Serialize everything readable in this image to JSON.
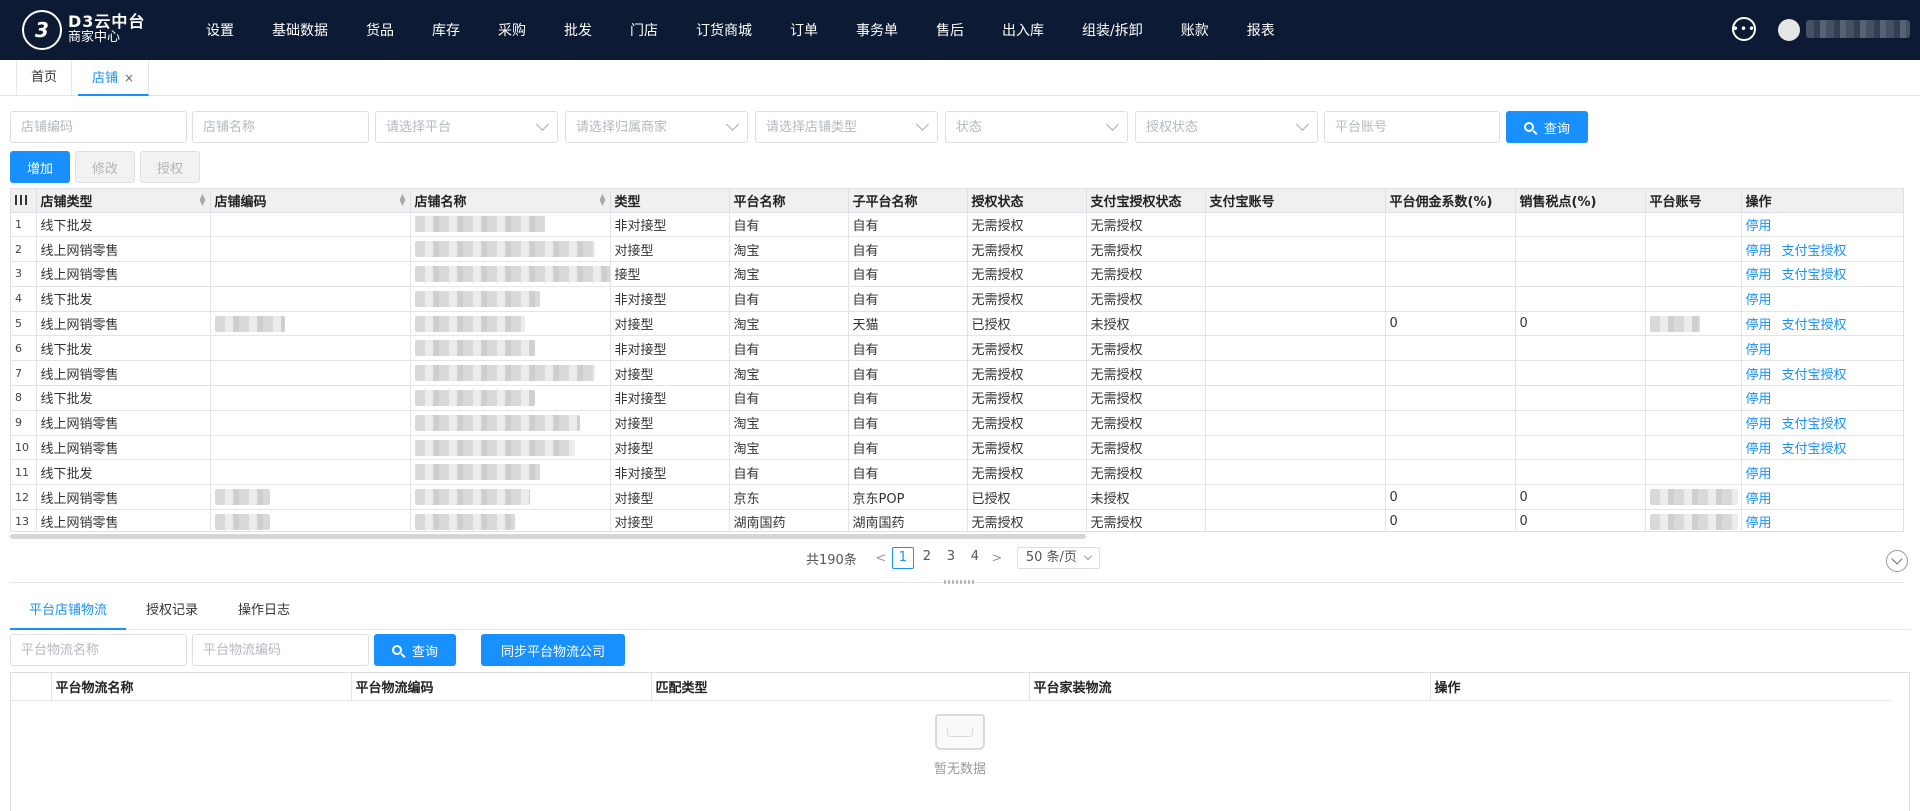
{
  "brand": {
    "title": "D3云中台",
    "subtitle": "商家中心",
    "mark": "3"
  },
  "nav": [
    "设置",
    "基础数据",
    "货品",
    "库存",
    "采购",
    "批发",
    "门店",
    "订货商城",
    "订单",
    "事务单",
    "售后",
    "出入库",
    "组装/拆卸",
    "账款",
    "报表"
  ],
  "tabs": {
    "home": "首页",
    "current": "店铺",
    "close": "×"
  },
  "filters": {
    "shop_code": "店铺编码",
    "shop_name": "店铺名称",
    "platform": "请选择平台",
    "merchant": "请选择归属商家",
    "shop_type": "请选择店铺类型",
    "status": "状态",
    "auth_status": "授权状态",
    "platform_account": "平台账号",
    "query": "查询"
  },
  "actions": {
    "add": "增加",
    "edit": "修改",
    "auth": "授权"
  },
  "columns": [
    "店铺类型",
    "店铺编码",
    "店铺名称",
    "类型",
    "平台名称",
    "子平台名称",
    "授权状态",
    "支付宝授权状态",
    "支付宝账号",
    "平台佣金系数(%)",
    "销售税点(%)",
    "平台账号",
    "操作"
  ],
  "rows": [
    {
      "idx": "1",
      "shop_type": "线下批发",
      "type": "非对接型",
      "platform": "自有",
      "sub_platform": "自有",
      "auth": "无需授权",
      "alipay_auth": "无需授权",
      "commission": "",
      "tax": "",
      "op1": "停用",
      "op2": ""
    },
    {
      "idx": "2",
      "shop_type": "线上网销零售",
      "type": "对接型",
      "platform": "淘宝",
      "sub_platform": "自有",
      "auth": "无需授权",
      "alipay_auth": "无需授权",
      "commission": "",
      "tax": "",
      "op1": "停用",
      "op2": "支付宝授权"
    },
    {
      "idx": "3",
      "shop_type": "线上网销零售",
      "type": "接型",
      "platform": "淘宝",
      "sub_platform": "自有",
      "auth": "无需授权",
      "alipay_auth": "无需授权",
      "commission": "",
      "tax": "",
      "op1": "停用",
      "op2": "支付宝授权"
    },
    {
      "idx": "4",
      "shop_type": "线下批发",
      "type": "非对接型",
      "platform": "自有",
      "sub_platform": "自有",
      "auth": "无需授权",
      "alipay_auth": "无需授权",
      "commission": "",
      "tax": "",
      "op1": "停用",
      "op2": ""
    },
    {
      "idx": "5",
      "shop_type": "线上网销零售",
      "type": "对接型",
      "platform": "淘宝",
      "sub_platform": "天猫",
      "auth": "已授权",
      "alipay_auth": "未授权",
      "commission": "0",
      "tax": "0",
      "op1": "停用",
      "op2": "支付宝授权"
    },
    {
      "idx": "6",
      "shop_type": "线下批发",
      "type": "非对接型",
      "platform": "自有",
      "sub_platform": "自有",
      "auth": "无需授权",
      "alipay_auth": "无需授权",
      "commission": "",
      "tax": "",
      "op1": "停用",
      "op2": ""
    },
    {
      "idx": "7",
      "shop_type": "线上网销零售",
      "type": "对接型",
      "platform": "淘宝",
      "sub_platform": "自有",
      "auth": "无需授权",
      "alipay_auth": "无需授权",
      "commission": "",
      "tax": "",
      "op1": "停用",
      "op2": "支付宝授权"
    },
    {
      "idx": "8",
      "shop_type": "线下批发",
      "type": "非对接型",
      "platform": "自有",
      "sub_platform": "自有",
      "auth": "无需授权",
      "alipay_auth": "无需授权",
      "commission": "",
      "tax": "",
      "op1": "停用",
      "op2": ""
    },
    {
      "idx": "9",
      "shop_type": "线上网销零售",
      "type": "对接型",
      "platform": "淘宝",
      "sub_platform": "自有",
      "auth": "无需授权",
      "alipay_auth": "无需授权",
      "commission": "",
      "tax": "",
      "op1": "停用",
      "op2": "支付宝授权"
    },
    {
      "idx": "10",
      "shop_type": "线上网销零售",
      "type": "对接型",
      "platform": "淘宝",
      "sub_platform": "自有",
      "auth": "无需授权",
      "alipay_auth": "无需授权",
      "commission": "",
      "tax": "",
      "op1": "停用",
      "op2": "支付宝授权"
    },
    {
      "idx": "11",
      "shop_type": "线下批发",
      "type": "非对接型",
      "platform": "自有",
      "sub_platform": "自有",
      "auth": "无需授权",
      "alipay_auth": "无需授权",
      "commission": "",
      "tax": "",
      "op1": "停用",
      "op2": ""
    },
    {
      "idx": "12",
      "shop_type": "线上网销零售",
      "type": "对接型",
      "platform": "京东",
      "sub_platform": "京东POP",
      "auth": "已授权",
      "alipay_auth": "未授权",
      "commission": "0",
      "tax": "0",
      "op1": "停用",
      "op2": ""
    },
    {
      "idx": "13",
      "shop_type": "线上网销零售",
      "type": "对接型",
      "platform": "湖南国药",
      "sub_platform": "湖南国药",
      "auth": "无需授权",
      "alipay_auth": "无需授权",
      "commission": "0",
      "tax": "0",
      "op1": "停用",
      "op2": ""
    }
  ],
  "pager": {
    "total": "共190条",
    "pages": [
      "1",
      "2",
      "3",
      "4"
    ],
    "current": "1",
    "size": "50 条/页",
    "prev": "<",
    "next": ">"
  },
  "bottom_tabs": [
    "平台店铺物流",
    "授权记录",
    "操作日志"
  ],
  "bottom_filters": {
    "name": "平台物流名称",
    "code": "平台物流编码",
    "query": "查询",
    "sync": "同步平台物流公司"
  },
  "bottom_columns": [
    "平台物流名称",
    "平台物流编码",
    "匹配类型",
    "平台家装物流",
    "操作"
  ],
  "empty_text": "暂无数据",
  "colors": {
    "topbar": "#0c1a33",
    "primary": "#1890ff"
  }
}
